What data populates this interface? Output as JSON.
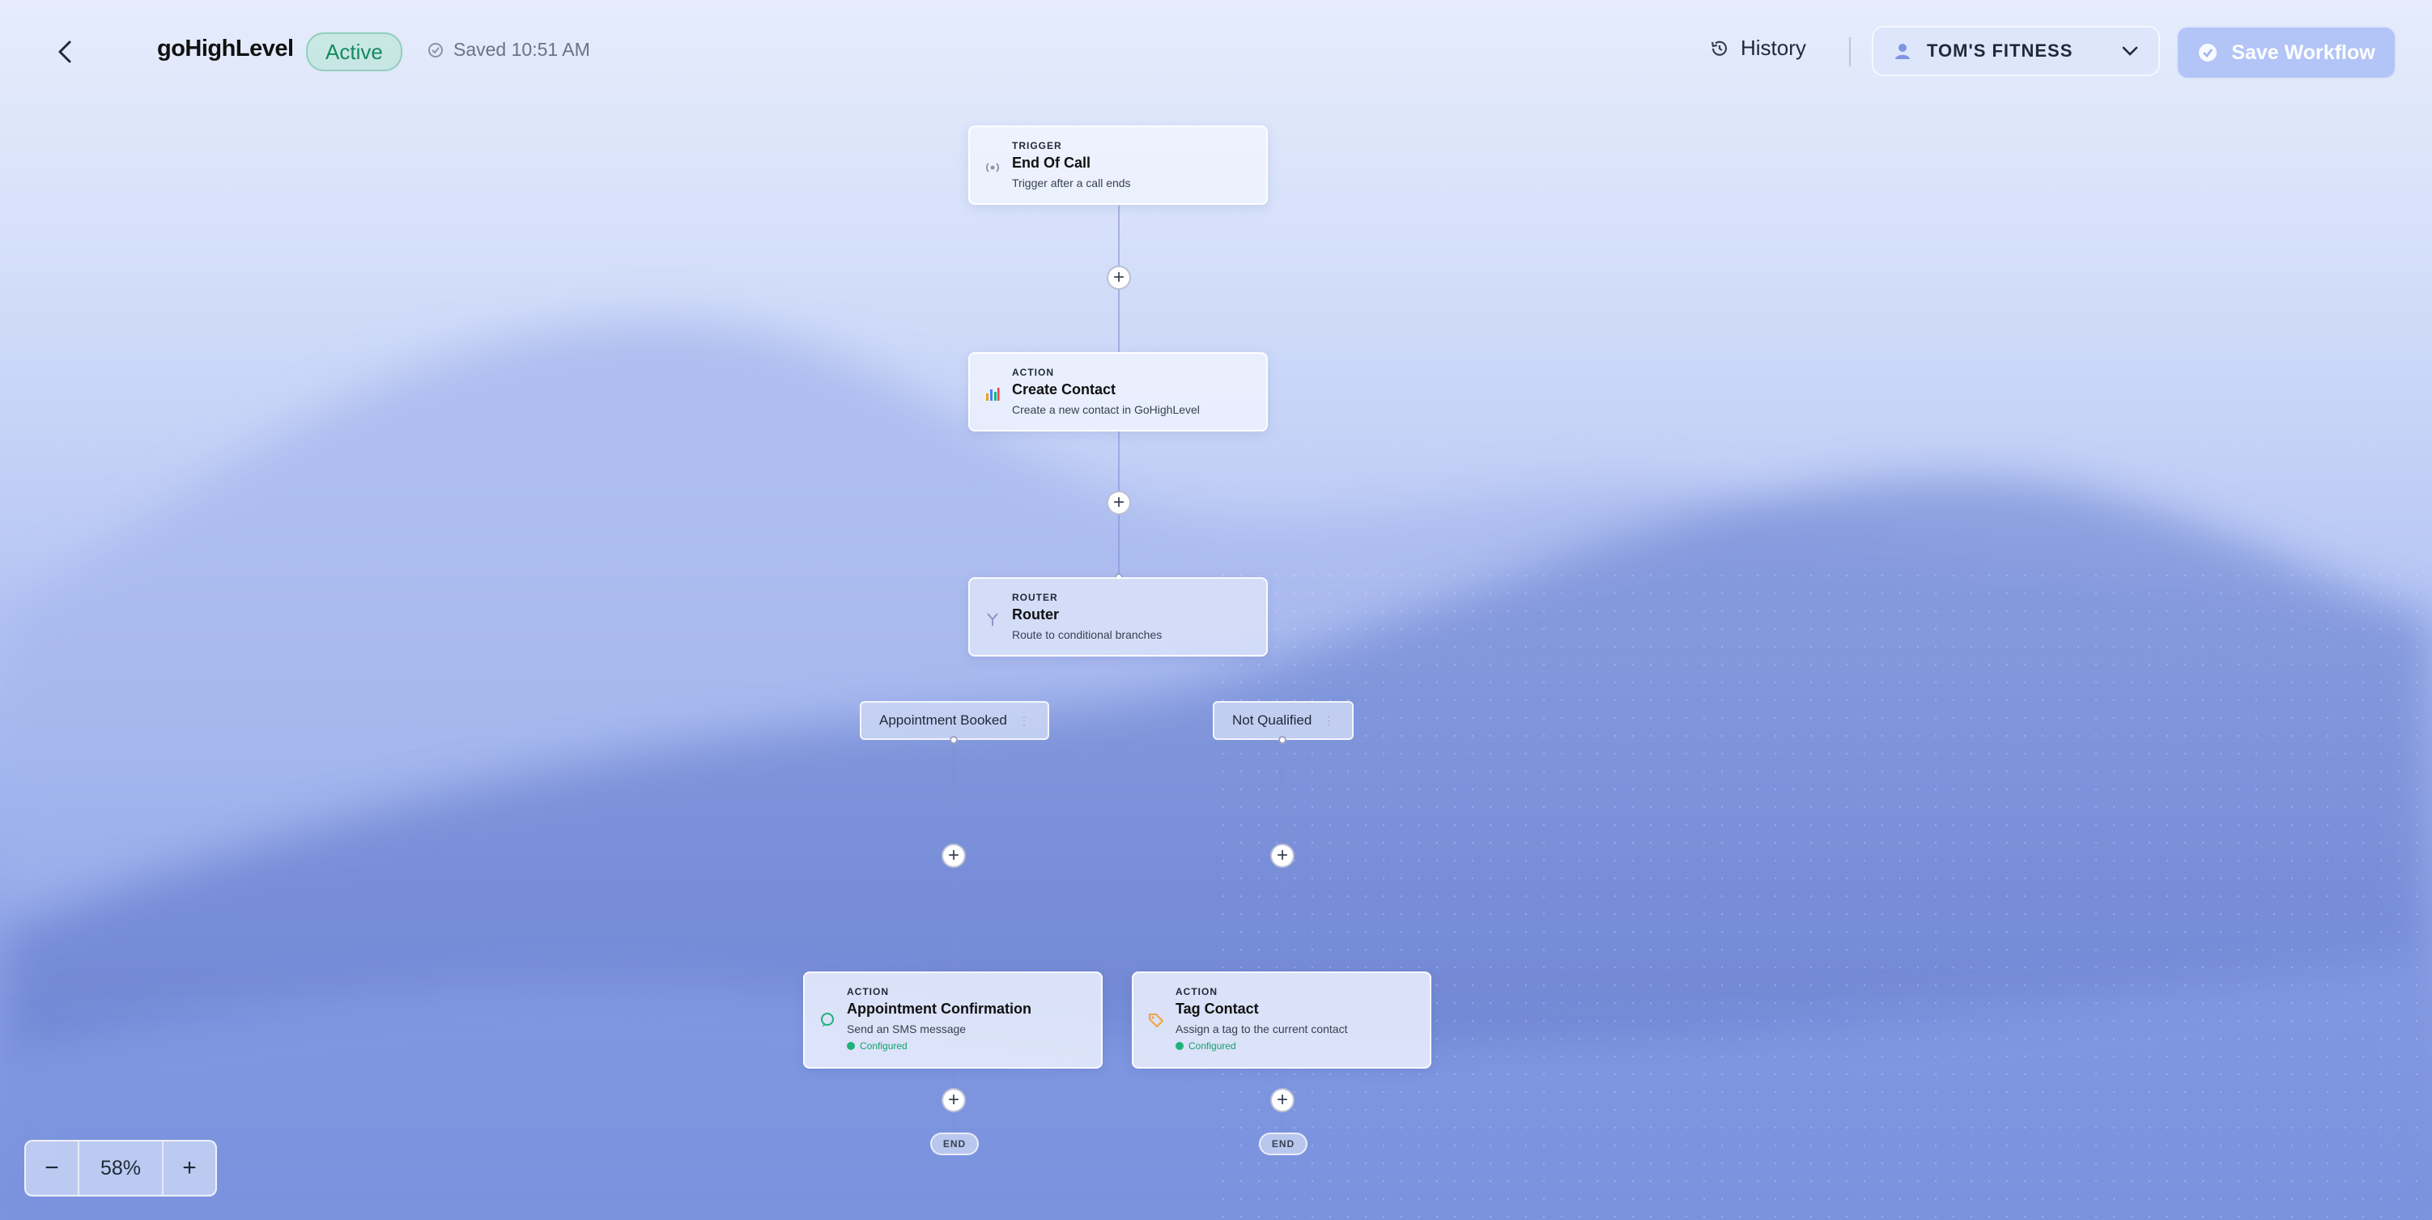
{
  "header": {
    "app_title": "goHighLevel",
    "status": "Active",
    "saved": "Saved 10:51 AM",
    "history_label": "History",
    "account_name": "TOM'S FITNESS",
    "save_label": "Save Workflow"
  },
  "flow": {
    "trigger": {
      "kind": "TRIGGER",
      "title": "End Of Call",
      "description": "Trigger after a call ends"
    },
    "create_contact": {
      "kind": "ACTION",
      "title": "Create Contact",
      "description": "Create a new contact in GoHighLevel"
    },
    "router": {
      "kind": "ROUTER",
      "title": "Router",
      "description": "Route to conditional branches"
    },
    "branches": [
      {
        "label": "Appointment Booked",
        "action": {
          "kind": "ACTION",
          "title": "Appointment Confirmation",
          "description": "Send an SMS message",
          "status": "Configured"
        },
        "end_label": "END"
      },
      {
        "label": "Not Qualified",
        "action": {
          "kind": "ACTION",
          "title": "Tag Contact",
          "description": "Assign a tag to the current contact",
          "status": "Configured"
        },
        "end_label": "END"
      }
    ],
    "add_step_symbol": "+"
  },
  "zoom": {
    "minus": "−",
    "value": "58%",
    "plus": "+"
  },
  "colors": {
    "accent": "#a9bdf3",
    "active_green": "#138a5e",
    "connector": "#8c96d6"
  },
  "icons": [
    "back-arrow-icon",
    "check-circle-icon",
    "history-icon",
    "user-icon",
    "chevron-down-icon",
    "broadcast-icon",
    "bar-chart-icon",
    "branch-icon",
    "chat-bubble-icon",
    "tag-icon"
  ]
}
